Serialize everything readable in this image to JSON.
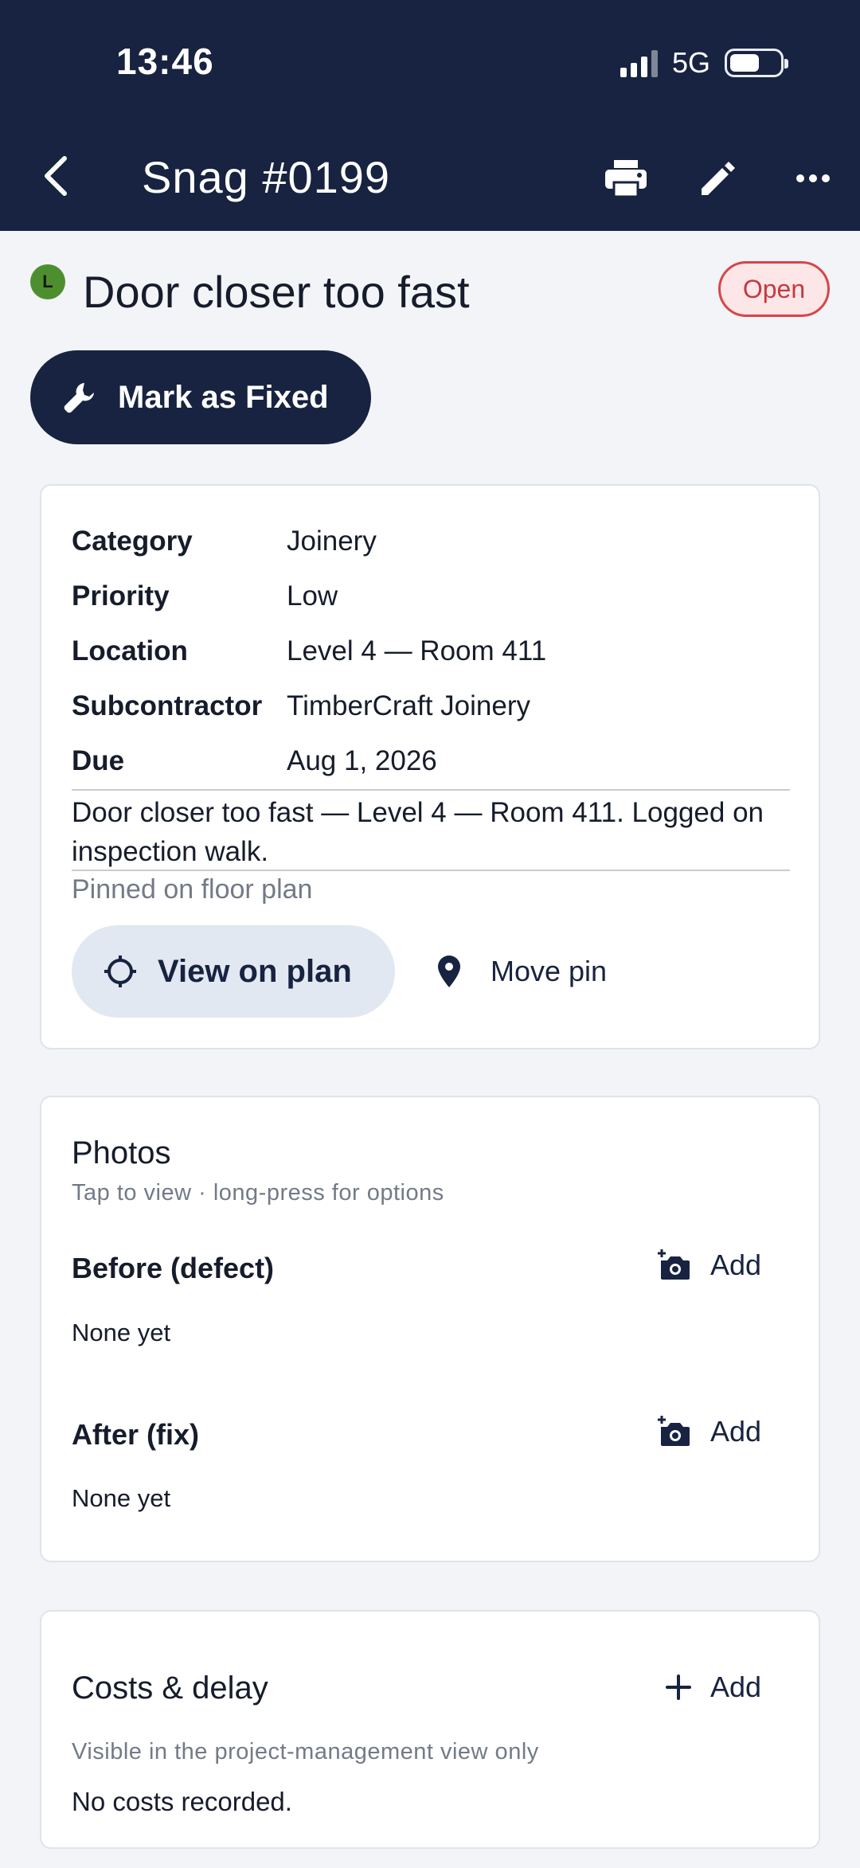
{
  "status_bar": {
    "time": "13:46",
    "network": "5G",
    "battery_level": 0.6
  },
  "header": {
    "title": "Snag #0199"
  },
  "snag": {
    "avatar_initial": "L",
    "avatar_color": "#4d8f2f",
    "title": "Door closer too fast",
    "status": "Open"
  },
  "mark_fixed_label": "Mark as Fixed",
  "details": {
    "rows": [
      {
        "label": "Category",
        "value": "Joinery"
      },
      {
        "label": "Priority",
        "value": "Low"
      },
      {
        "label": "Location",
        "value": "Level 4 — Room 411"
      },
      {
        "label": "Subcontractor",
        "value": "TimberCraft Joinery"
      },
      {
        "label": "Due",
        "value": "Aug 1, 2026"
      }
    ],
    "description": "Door closer too fast — Level 4 — Room 411. Logged on inspection walk.",
    "pinned_text": "Pinned on floor plan",
    "view_on_plan": "View on plan",
    "move_pin": "Move pin"
  },
  "photos": {
    "title": "Photos",
    "subtitle": "Tap to view · long-press for options",
    "before": {
      "label": "Before (defect)",
      "empty": "None yet",
      "add": "Add"
    },
    "after": {
      "label": "After (fix)",
      "empty": "None yet",
      "add": "Add"
    }
  },
  "costs": {
    "title": "Costs & delay",
    "add": "Add",
    "subtitle": "Visible in the project-management view only",
    "empty": "No costs recorded."
  },
  "colors": {
    "header_bg": "#172340",
    "status_open": "#c43a3f",
    "status_open_bg": "#fde6e7"
  }
}
